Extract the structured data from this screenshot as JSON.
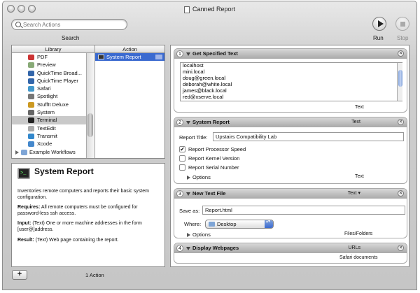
{
  "window": {
    "title": "Canned Report"
  },
  "toolbar": {
    "search_placeholder": "Search Actions",
    "search_label": "Search",
    "run_label": "Run",
    "stop_label": "Stop"
  },
  "library": {
    "header_library": "Library",
    "header_action": "Action",
    "items": [
      {
        "label": "PDF",
        "icon": "pdf-icon",
        "color": "#c33"
      },
      {
        "label": "Preview",
        "icon": "preview-icon",
        "color": "#8a7"
      },
      {
        "label": "QuickTime Broad...",
        "icon": "quicktime-icon",
        "color": "#36a"
      },
      {
        "label": "QuickTime Player",
        "icon": "quicktime-icon",
        "color": "#36a"
      },
      {
        "label": "Safari",
        "icon": "safari-icon",
        "color": "#49c"
      },
      {
        "label": "Spotlight",
        "icon": "spotlight-icon",
        "color": "#777"
      },
      {
        "label": "StuffIt Deluxe",
        "icon": "stuffit-icon",
        "color": "#c92"
      },
      {
        "label": "System",
        "icon": "system-icon",
        "color": "#666"
      },
      {
        "label": "Terminal",
        "icon": "terminal-icon",
        "color": "#222"
      },
      {
        "label": "TextEdit",
        "icon": "textedit-icon",
        "color": "#aaa"
      },
      {
        "label": "Transmit",
        "icon": "transmit-icon",
        "color": "#38c"
      },
      {
        "label": "Xcode",
        "icon": "xcode-icon",
        "color": "#48c"
      },
      {
        "label": "Example Workflows",
        "icon": "folder-icon",
        "color": "#7ea5d6"
      }
    ],
    "selected_index": 8,
    "actions": [
      {
        "label": "System Report"
      }
    ]
  },
  "description": {
    "title": "System Report",
    "summary": "Inventories remote computers and reports their basic system configuration.",
    "requires_label": "Requires:",
    "requires_text": "All remote computers must be configured for password-less ssh access.",
    "input_label": "Input:",
    "input_text": "(Text) One or more machine addresses in the form [user@]address.",
    "result_label": "Result:",
    "result_text": "(Text) Web page containing the report."
  },
  "workflow": {
    "card1": {
      "number": "1",
      "title": "Get Specified Text",
      "text": "localhost\nmini.local\ndoug@green.local\ndeborah@white.local\njames@black.local\nred@xserve.local",
      "output": "Text"
    },
    "card2": {
      "number": "2",
      "title": "System Report",
      "input_type": "Text",
      "report_title_label": "Report Title:",
      "report_title_value": "Upstairs Compatibility Lab",
      "options": [
        {
          "label": "Report Processor Speed",
          "checked": true
        },
        {
          "label": "Report Kernel Version",
          "checked": false
        },
        {
          "label": "Report Serial Number",
          "checked": false
        }
      ],
      "options_label": "Options",
      "output": "Text"
    },
    "card3": {
      "number": "3",
      "title": "New Text File",
      "input_type": "Text ▾",
      "save_as_label": "Save as:",
      "save_as_value": "Report.html",
      "where_label": "Where:",
      "where_value": "Desktop",
      "options_label": "Options",
      "output": "Files/Folders"
    },
    "card4": {
      "number": "4",
      "title": "Display Webpages",
      "input_type": "URLs",
      "output": "Safari documents"
    }
  },
  "status": {
    "add_label": "+",
    "count_label": "1 Action"
  }
}
